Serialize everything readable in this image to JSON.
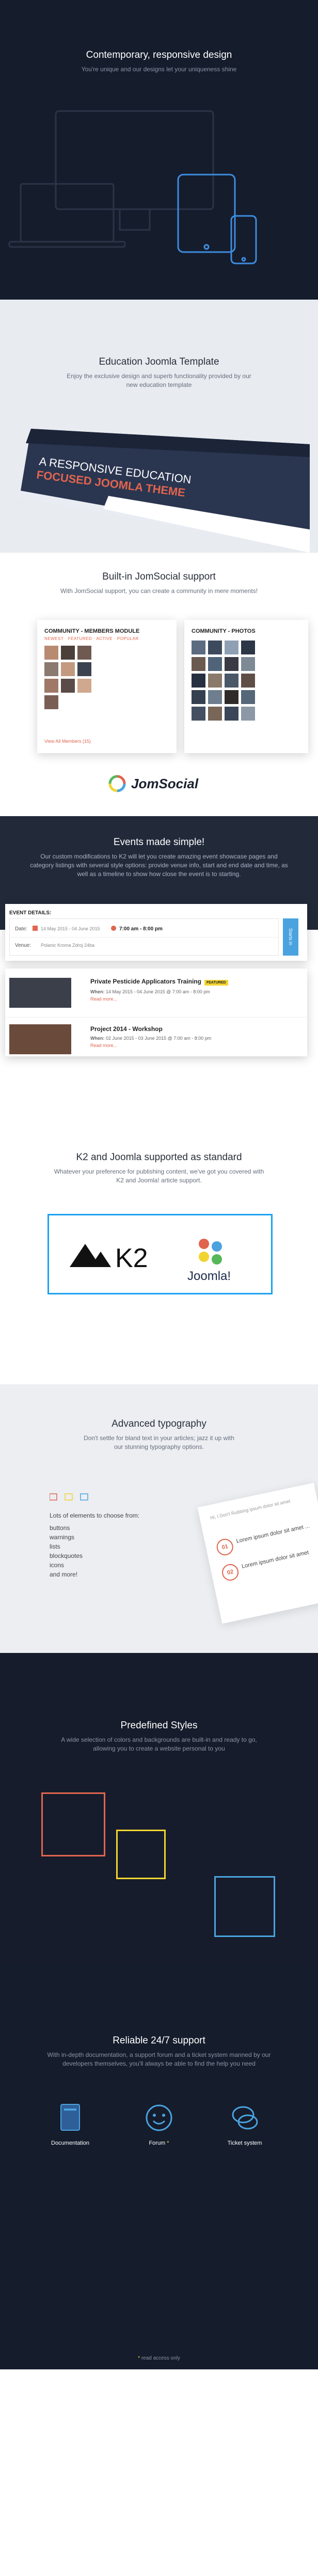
{
  "responsive": {
    "title": "Contemporary, responsive design",
    "subtitle": "You're unique and our designs let your uniqueness shine"
  },
  "education": {
    "title": "Education Joomla Template",
    "subtitle": "Enjoy the exclusive design and superb functionality provided by our new education template",
    "mock_headline_1": "A RESPONSIVE EDUCATION",
    "mock_headline_2": "FOCUSED JOOMLA THEME"
  },
  "jomsocial": {
    "title": "Built-in JomSocial support",
    "subtitle": "With JomSocial support, you can create a community in mere moments!",
    "members_heading": "COMMUNITY - MEMBERS MODULE",
    "filters": "NEWEST · FEATURED · ACTIVE · POPULAR",
    "view_all": "View All Members (15)",
    "photos_heading": "COMMUNITY - PHOTOS",
    "logo_text": "JomSocial"
  },
  "events": {
    "title": "Events made simple!",
    "subtitle": "Our custom modifications to K2 will let you create amazing event showcase pages and category listings with several style options: provide venue info, start and end date and time, as well as a timeline to show how close the event is to starting.",
    "details_heading": "EVENT DETAILS:",
    "date_label": "Date:",
    "date_value": "14 May 2015 - 04 June 2015",
    "time_value": "7:00 am - 8:00 pm",
    "venue_label": "Venue:",
    "venue_value": "Polanic Kroma Zdroj 24ba",
    "side_tab": "Starts in",
    "items": [
      {
        "title": "Private Pesticide Applicators Training",
        "badge": "FEATURED",
        "when": "14 May 2015 - 04 June 2015 @ 7:00 am - 8:00 pm",
        "read_more": "Read more..."
      },
      {
        "title": "Project 2014 - Workshop",
        "badge": "",
        "when": "02 June 2015 - 03 June 2015 @ 7:00 am - 8:00 pm",
        "read_more": "Read more..."
      }
    ],
    "when_label": "When:"
  },
  "k2": {
    "title": "K2 and Joomla supported as standard",
    "subtitle": "Whatever your preference for publishing content, we've got you covered with K2 and Joomla! article support.",
    "k2_text": "K2",
    "joomla_text": "Joomla!"
  },
  "typography": {
    "title": "Advanced typography",
    "subtitle": "Don't settle for bland text in your articles; jazz it up with our stunning typography options.",
    "list_intro": "Lots of elements to choose from:",
    "list": [
      "buttons",
      "warnings",
      "lists",
      "blockquotes",
      "icons",
      "and more!"
    ],
    "card_header": "Hi, I Don't Rubbing ipsum dolor sit amet",
    "card_item_1": "Lorem ipsum dolor sit amet ...",
    "card_item_2": "Lorem ipsum dolor sit amet",
    "num_1": "01",
    "num_2": "02"
  },
  "styles": {
    "title": "Predefined Styles",
    "subtitle": "A wide selection of colors and backgrounds are built-in and ready to go, allowing you to create a website personal to you",
    "colors": [
      "#e0654e",
      "#f2d431",
      "#4aa3df"
    ]
  },
  "support": {
    "title": "Reliable 24/7 support",
    "subtitle": "With in-depth documentation, a support forum and a ticket system manned by our developers themselves, you'll always be able to find the help you need",
    "items": [
      {
        "label": "Documentation"
      },
      {
        "label": "Forum"
      },
      {
        "label": "Ticket system"
      }
    ],
    "forum_star": "*",
    "note_star": "*",
    "note": "read access only"
  }
}
